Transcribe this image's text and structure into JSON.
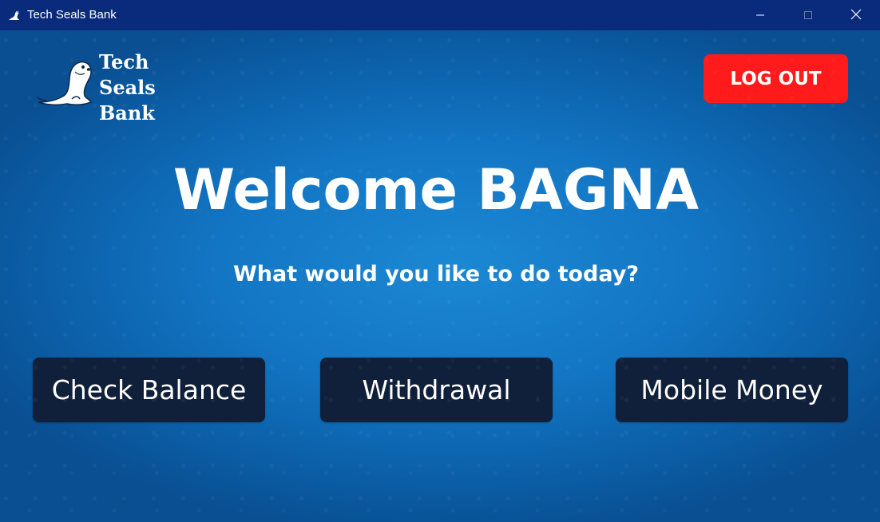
{
  "window": {
    "title": "Tech Seals Bank",
    "app_icon": "seal-icon",
    "controls": [
      "minimize-icon",
      "maximize-icon",
      "close-icon"
    ]
  },
  "logo": {
    "lines": [
      "Tech",
      "Seals",
      "Bank"
    ],
    "icon": "seal-logo"
  },
  "header": {
    "logout_label": "LOG OUT"
  },
  "main": {
    "welcome": "Welcome BAGNA",
    "subtitle": "What would you like to do today?",
    "actions": [
      {
        "label": "Check Balance"
      },
      {
        "label": "Withdrawal"
      },
      {
        "label": "Mobile Money"
      }
    ]
  },
  "colors": {
    "titlebar": "#0a2a7c",
    "background": "#1376c4",
    "logout": "#ff1b1b",
    "action_button": "#10203a",
    "text": "#ffffff"
  }
}
